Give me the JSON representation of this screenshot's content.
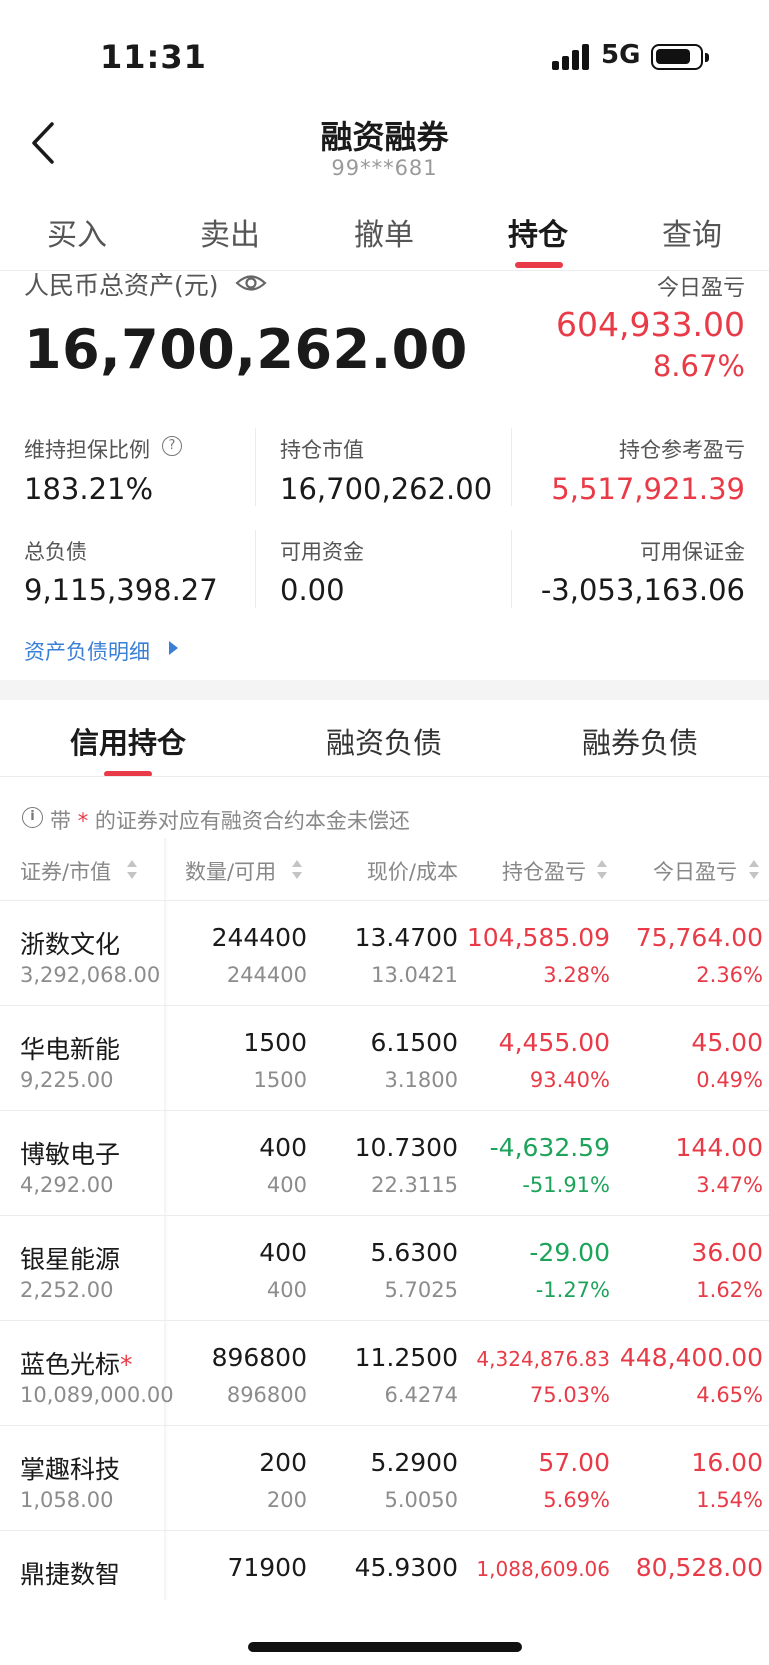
{
  "status_bar": {
    "time": "11:31",
    "network": "5G"
  },
  "header": {
    "title": "融资融券",
    "account": "99***681"
  },
  "top_tabs": [
    {
      "label": "买入"
    },
    {
      "label": "卖出"
    },
    {
      "label": "撤单"
    },
    {
      "label": "持仓",
      "active": true
    },
    {
      "label": "查询"
    }
  ],
  "assets": {
    "label": "人民币总资产(元)",
    "total": "16,700,262.00",
    "today_pl_label": "今日盈亏",
    "today_pl": "604,933.00",
    "today_pl_pct": "8.67%"
  },
  "metrics": [
    {
      "label": "维持担保比例",
      "value": "183.21%"
    },
    {
      "label": "持仓市值",
      "value": "16,700,262.00"
    },
    {
      "label": "持仓参考盈亏",
      "value": "5,517,921.39"
    },
    {
      "label": "总负债",
      "value": "9,115,398.27"
    },
    {
      "label": "可用资金",
      "value": "0.00"
    },
    {
      "label": "可用保证金",
      "value": "-3,053,163.06"
    }
  ],
  "detail_link": "资产负债明细",
  "sub_tabs": [
    {
      "label": "信用持仓",
      "active": true
    },
    {
      "label": "融资负债"
    },
    {
      "label": "融券负债"
    }
  ],
  "notice": {
    "prefix": "带",
    "star": "*",
    "text": "的证券对应有融资合约本金未偿还"
  },
  "table": {
    "headers": [
      "证券/市值",
      "数量/可用",
      "现价/成本",
      "持仓盈亏",
      "今日盈亏"
    ],
    "rows": [
      {
        "name": "浙数文化",
        "star": "",
        "market_value": "3,292,068.00",
        "qty": "244400",
        "avail": "244400",
        "price": "13.4700",
        "cost": "13.0421",
        "hold_pl": "104,585.09",
        "hold_pct": "3.28%",
        "today_pl": "75,764.00",
        "today_pct": "2.36%",
        "hold_color": "red",
        "today_color": "red"
      },
      {
        "name": "华电新能",
        "star": "",
        "market_value": "9,225.00",
        "qty": "1500",
        "avail": "1500",
        "price": "6.1500",
        "cost": "3.1800",
        "hold_pl": "4,455.00",
        "hold_pct": "93.40%",
        "today_pl": "45.00",
        "today_pct": "0.49%",
        "hold_color": "red",
        "today_color": "red"
      },
      {
        "name": "博敏电子",
        "star": "",
        "market_value": "4,292.00",
        "qty": "400",
        "avail": "400",
        "price": "10.7300",
        "cost": "22.3115",
        "hold_pl": "-4,632.59",
        "hold_pct": "-51.91%",
        "today_pl": "144.00",
        "today_pct": "3.47%",
        "hold_color": "green",
        "today_color": "red"
      },
      {
        "name": "银星能源",
        "star": "",
        "market_value": "2,252.00",
        "qty": "400",
        "avail": "400",
        "price": "5.6300",
        "cost": "5.7025",
        "hold_pl": "-29.00",
        "hold_pct": "-1.27%",
        "today_pl": "36.00",
        "today_pct": "1.62%",
        "hold_color": "green",
        "today_color": "red"
      },
      {
        "name": "蓝色光标",
        "star": "*",
        "market_value": "10,089,000.00",
        "qty": "896800",
        "avail": "896800",
        "price": "11.2500",
        "cost": "6.4274",
        "hold_pl": "4,324,876.83",
        "hold_pct": "75.03%",
        "today_pl": "448,400.00",
        "today_pct": "4.65%",
        "hold_color": "red",
        "today_color": "red"
      },
      {
        "name": "掌趣科技",
        "star": "",
        "market_value": "1,058.00",
        "qty": "200",
        "avail": "200",
        "price": "5.2900",
        "cost": "5.0050",
        "hold_pl": "57.00",
        "hold_pct": "5.69%",
        "today_pl": "16.00",
        "today_pct": "1.54%",
        "hold_color": "red",
        "today_color": "red"
      },
      {
        "name": "鼎捷数智",
        "star": "",
        "market_value": "",
        "qty": "71900",
        "avail": "",
        "price": "45.9300",
        "cost": "",
        "hold_pl": "1,088,609.06",
        "hold_pct": "",
        "today_pl": "80,528.00",
        "today_pct": "",
        "hold_color": "red",
        "today_color": "red"
      }
    ]
  },
  "colors": {
    "accent": "#e83b47",
    "gain": "#e83b47",
    "loss": "#1ea35a",
    "link": "#3a7fd6"
  }
}
